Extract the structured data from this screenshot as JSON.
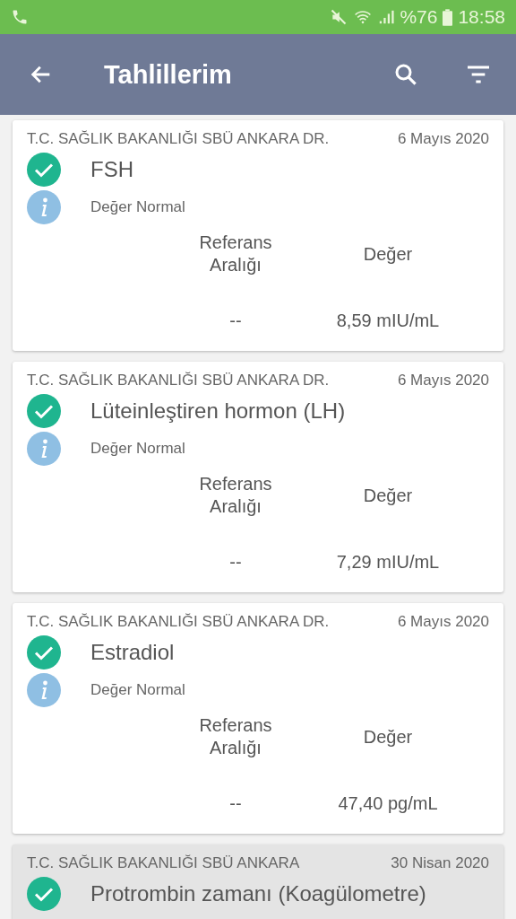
{
  "status_bar": {
    "battery": "%76",
    "time": "18:58"
  },
  "app_bar": {
    "title": "Tahlillerim"
  },
  "results": [
    {
      "institution": "T.C. SAĞLIK BAKANLIĞI SBÜ ANKARA DR.",
      "date": "6 Mayıs 2020",
      "test": "FSH",
      "status": "Değer Normal",
      "reference_header": "Referans Aralığı",
      "value_header": "Değer",
      "reference": "--",
      "value": "8,59 mIU/mL",
      "highlighted": false
    },
    {
      "institution": "T.C. SAĞLIK BAKANLIĞI SBÜ ANKARA DR.",
      "date": "6 Mayıs 2020",
      "test": "Lüteinleştiren hormon (LH)",
      "status": "Değer Normal",
      "reference_header": "Referans Aralığı",
      "value_header": "Değer",
      "reference": "--",
      "value": "7,29 mIU/mL",
      "highlighted": false
    },
    {
      "institution": "T.C. SAĞLIK BAKANLIĞI SBÜ ANKARA DR.",
      "date": "6 Mayıs 2020",
      "test": "Estradiol",
      "status": "Değer Normal",
      "reference_header": "Referans Aralığı",
      "value_header": "Değer",
      "reference": "--",
      "value": "47,40 pg/mL",
      "highlighted": false
    },
    {
      "institution": "T.C. SAĞLIK BAKANLIĞI SBÜ ANKARA",
      "date": "30 Nisan 2020",
      "test": "Protrombin zamanı (Koagülometre)",
      "highlighted": true
    }
  ]
}
